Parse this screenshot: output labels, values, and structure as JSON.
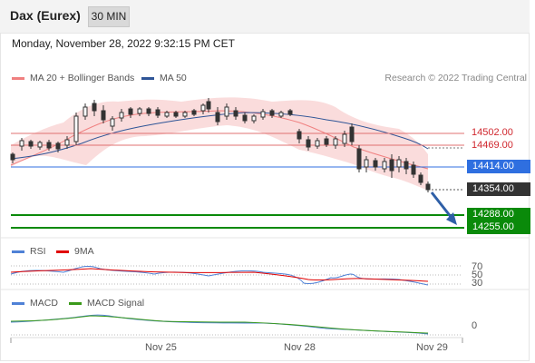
{
  "header": {
    "instrument": "Dax (Eurex)",
    "timeframe": "30 MIN"
  },
  "datetime": "Monday, November 28, 2022 9:32:15 PM CET",
  "legend": {
    "bb": {
      "label": "MA 20 + Bollinger Bands",
      "color": "#f08080"
    },
    "ma50": {
      "label": "MA 50",
      "color": "#2f5597"
    }
  },
  "credit": "Research © 2022 Trading Central",
  "levels": {
    "r2": "14502.00",
    "r1": "14469.00",
    "pivot": "14414.00",
    "last": "14354.00",
    "s1": "14288.00",
    "s2": "14255.00"
  },
  "rsi": {
    "label": "RSI",
    "signal_label": "9MA",
    "rsi_color": "#4f81d6",
    "signal_color": "#e00000",
    "levels": [
      "70",
      "50",
      "30"
    ]
  },
  "macd": {
    "label": "MACD",
    "signal_label": "MACD Signal",
    "macd_color": "#4f81d6",
    "signal_color": "#3a9a1a",
    "zero": "0"
  },
  "xaxis": {
    "labels": [
      "Nov 25",
      "Nov 28",
      "Nov 29"
    ]
  },
  "colors": {
    "support": "#0a8a0a",
    "pivot": "#2f6fe0",
    "resistance": "#e07070",
    "last": "#333333",
    "arrow": "#2f5fa7",
    "candle_up": "#ffffff",
    "candle_down": "#333333"
  }
}
